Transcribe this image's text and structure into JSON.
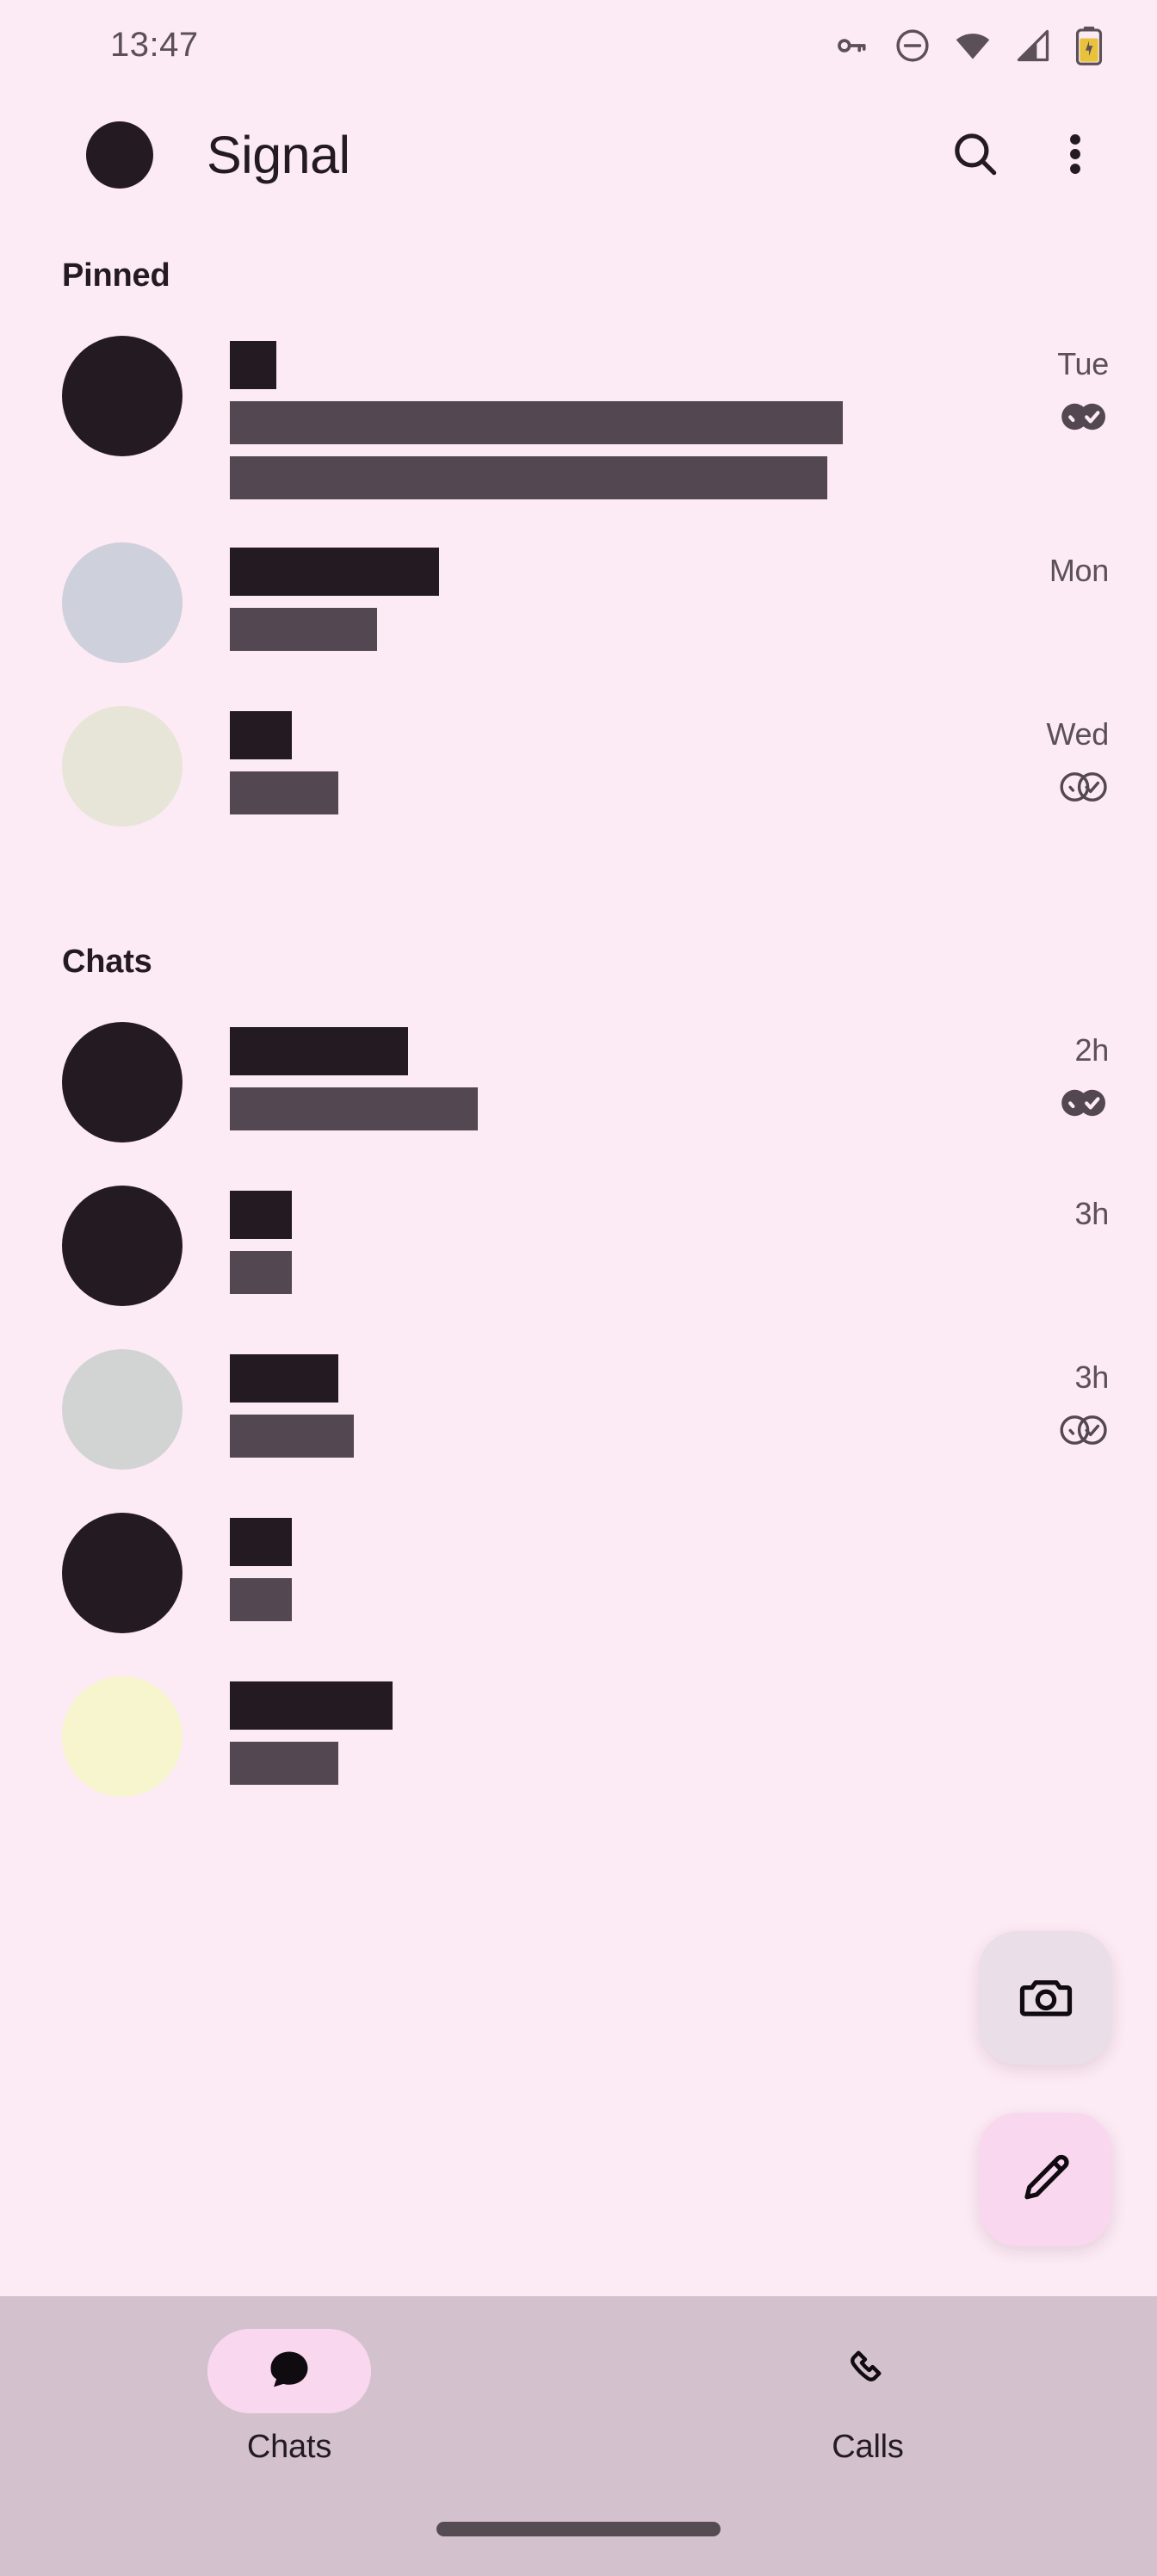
{
  "status_bar": {
    "clock": "13:47",
    "icons": [
      "vpn-key-icon",
      "do-not-disturb-icon",
      "wifi-icon",
      "cellular-signal-icon",
      "battery-charging-icon"
    ]
  },
  "app_bar": {
    "title": "Signal",
    "avatar_color": "#241A22",
    "search_label": "Search",
    "overflow_label": "More options"
  },
  "theme": {
    "background": "#FCEAF4",
    "accent_pink": "#F9D8EF",
    "nav_background": "#D3C2CE",
    "text_primary": "#241A22",
    "text_secondary": "#5C5057",
    "redact_name": "#241A22",
    "redact_preview": "#534751"
  },
  "sections": [
    {
      "id": "pinned",
      "header": "Pinned",
      "rows": [
        {
          "avatar_color": "#241A22",
          "time": "Tue",
          "status": "read",
          "name_width_pct": 6,
          "preview_widths_pct": [
            79,
            77
          ]
        },
        {
          "avatar_color": "#CED0DB",
          "time": "Mon",
          "status": "none",
          "name_width_pct": 27,
          "preview_widths_pct": [
            19
          ]
        },
        {
          "avatar_color": "#E6E5D8",
          "time": "Wed",
          "status": "delivered",
          "name_width_pct": 8,
          "preview_widths_pct": [
            14
          ]
        }
      ]
    },
    {
      "id": "chats",
      "header": "Chats",
      "rows": [
        {
          "avatar_color": "#241A22",
          "time": "2h",
          "status": "read",
          "name_width_pct": 23,
          "preview_widths_pct": [
            32
          ]
        },
        {
          "avatar_color": "#241A22",
          "time": "3h",
          "status": "none",
          "name_width_pct": 8,
          "preview_widths_pct": [
            8
          ]
        },
        {
          "avatar_color": "#D2D4D3",
          "time": "3h",
          "status": "delivered",
          "name_width_pct": 14,
          "preview_widths_pct": [
            16
          ]
        },
        {
          "avatar_color": "#241A22",
          "time": "",
          "status": "none",
          "name_width_pct": 8,
          "preview_widths_pct": [
            8
          ]
        },
        {
          "avatar_color": "#F7F5CD",
          "time": "",
          "status": "none",
          "name_width_pct": 21,
          "preview_widths_pct": [
            14
          ]
        }
      ]
    }
  ],
  "fabs": [
    {
      "name": "camera",
      "label": "Camera",
      "icon": "camera-icon",
      "background": "#EADEE8"
    },
    {
      "name": "compose",
      "label": "New chat",
      "icon": "pencil-icon",
      "background": "#F9D8EF"
    }
  ],
  "bottom_nav": {
    "items": [
      {
        "label": "Chats",
        "icon": "chat-bubble-icon",
        "active": true
      },
      {
        "label": "Calls",
        "icon": "phone-icon",
        "active": false
      }
    ]
  }
}
